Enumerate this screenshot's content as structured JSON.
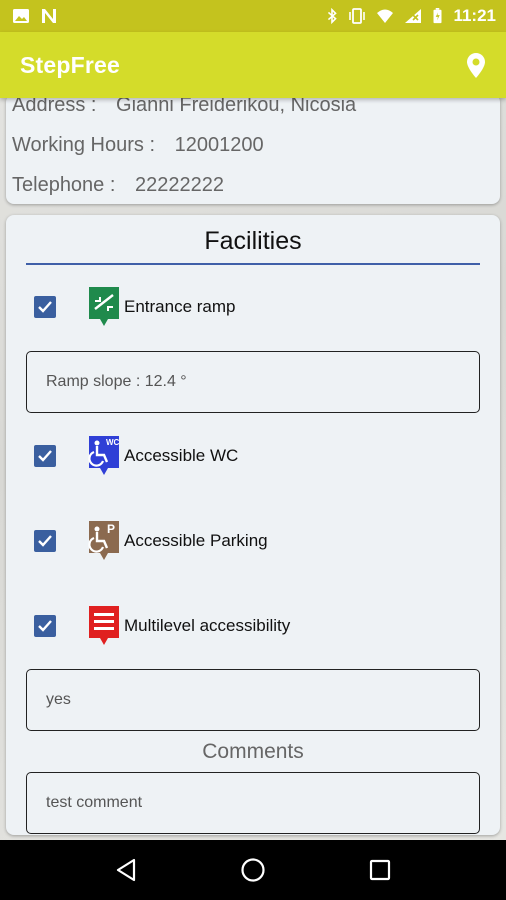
{
  "status_bar": {
    "time": "11:21",
    "left_icons": [
      "image-icon",
      "n-notification-icon"
    ],
    "right_icons": [
      "bluetooth-icon",
      "vibrate-icon",
      "wifi-icon",
      "signal-icon",
      "battery-icon"
    ]
  },
  "app_bar": {
    "title": "StepFree",
    "action_icon": "location-pin-icon"
  },
  "info": {
    "address_label": "Address :",
    "address_value": "Gianni Freiderikou, Nicosia",
    "hours_label": "Working Hours :",
    "hours_value": "12001200",
    "phone_label": "Telephone :",
    "phone_value": "22222222"
  },
  "facilities": {
    "title": "Facilities",
    "items": [
      {
        "label": "Entrance ramp",
        "checked": true,
        "icon": "ramp-icon",
        "color": "#1f8a4c"
      },
      {
        "label": "Accessible WC",
        "checked": true,
        "icon": "wheelchair-wc-icon",
        "color": "#2f3fd6"
      },
      {
        "label": "Accessible Parking",
        "checked": true,
        "icon": "wheelchair-parking-icon",
        "color": "#8b6a4f"
      },
      {
        "label": "Multilevel accessibility",
        "checked": true,
        "icon": "elevator-icon",
        "color": "#e02020"
      }
    ],
    "ramp_slope": "Ramp slope : 12.4 °",
    "multilevel_value": "yes",
    "comments_label": "Comments",
    "comment_value": "test comment"
  },
  "colors": {
    "status_bar": "#c4c31e",
    "app_bar": "#d4dc2a",
    "checkbox": "#3a5f9f",
    "divider": "#3f5fa8"
  },
  "nav_bar": {
    "icons": [
      "back-icon",
      "home-icon",
      "recents-icon"
    ]
  }
}
